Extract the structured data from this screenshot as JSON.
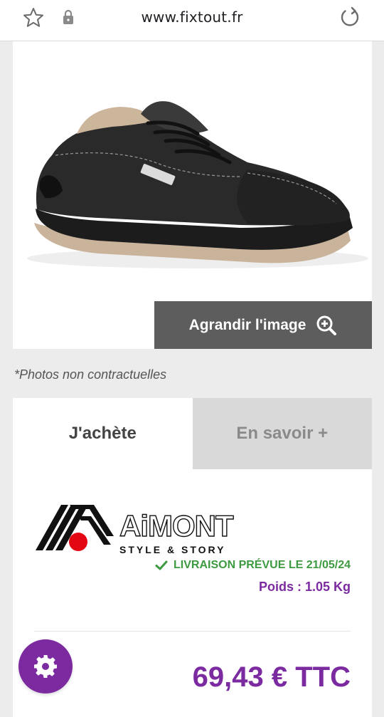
{
  "browser": {
    "url": "www.fixtout.fr",
    "icons": {
      "bookmark": "star-outline-icon",
      "security": "lock-icon",
      "reload": "reload-icon"
    }
  },
  "product_image": {
    "alt": "Chaussure de sécurité AIMONT noire",
    "zoom_button_label": "Agrandir l'image",
    "zoom_icon": "zoom-in-icon"
  },
  "disclaimer": "*Photos non contractuelles",
  "tabs": [
    {
      "label": "J'achète",
      "active": true
    },
    {
      "label": "En savoir +",
      "active": false
    }
  ],
  "product": {
    "brand": {
      "name": "AiMONT",
      "tagline": "STYLE & STORY"
    },
    "delivery": "LIVRAISON PRÉVUE LE 21/05/24",
    "weight": "Poids : 1.05 Kg",
    "price": "69,43 € TTC"
  },
  "colors": {
    "accent": "#7b2aa0",
    "success": "#3d9a40",
    "button_dark": "#5d5d5d",
    "tab_inactive": "#d9d9d9",
    "brand_red": "#e30613"
  },
  "fab": {
    "icon": "gear-icon"
  }
}
